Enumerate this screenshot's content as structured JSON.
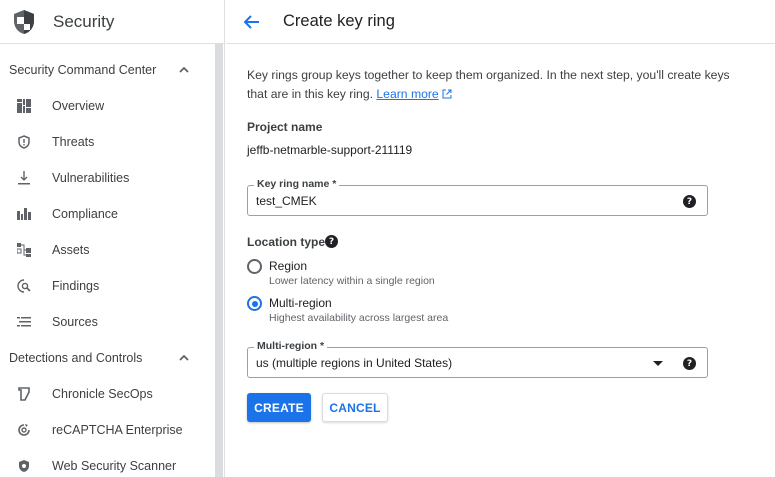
{
  "app": {
    "title": "Security"
  },
  "sidebar": {
    "sections": [
      {
        "label": "Security Command Center",
        "items": [
          {
            "label": "Overview",
            "icon": "dashboard-icon"
          },
          {
            "label": "Threats",
            "icon": "shield-outline-icon"
          },
          {
            "label": "Vulnerabilities",
            "icon": "download-tray-icon"
          },
          {
            "label": "Compliance",
            "icon": "bar-chart-icon"
          },
          {
            "label": "Assets",
            "icon": "hierarchy-icon"
          },
          {
            "label": "Findings",
            "icon": "search-doc-icon"
          },
          {
            "label": "Sources",
            "icon": "list-icon"
          }
        ]
      },
      {
        "label": "Detections and Controls",
        "items": [
          {
            "label": "Chronicle SecOps",
            "icon": "chronicle-icon"
          },
          {
            "label": "reCAPTCHA Enterprise",
            "icon": "recaptcha-icon"
          },
          {
            "label": "Web Security Scanner",
            "icon": "shield-filled-icon"
          }
        ]
      }
    ]
  },
  "header": {
    "title": "Create key ring"
  },
  "form": {
    "description": "Key rings group keys together to keep them organized. In the next step, you'll create keys that are in this key ring.",
    "learn_more": "Learn more",
    "project_label": "Project name",
    "project_value": "jeffb-netmarble-support-211119",
    "key_ring_label": "Key ring name *",
    "key_ring_value": "test_CMEK",
    "location_type_label": "Location type",
    "region_option": {
      "label": "Region",
      "sub": "Lower latency within a single region",
      "checked": false
    },
    "multi_region_option": {
      "label": "Multi-region",
      "sub": "Highest availability across largest area",
      "checked": true
    },
    "multi_region_select_label": "Multi-region *",
    "multi_region_select_value": "us (multiple regions in United States)",
    "create_button": "CREATE",
    "cancel_button": "CANCEL"
  },
  "colors": {
    "accent": "#1a73e8",
    "text": "#202124",
    "muted": "#5f6368"
  }
}
